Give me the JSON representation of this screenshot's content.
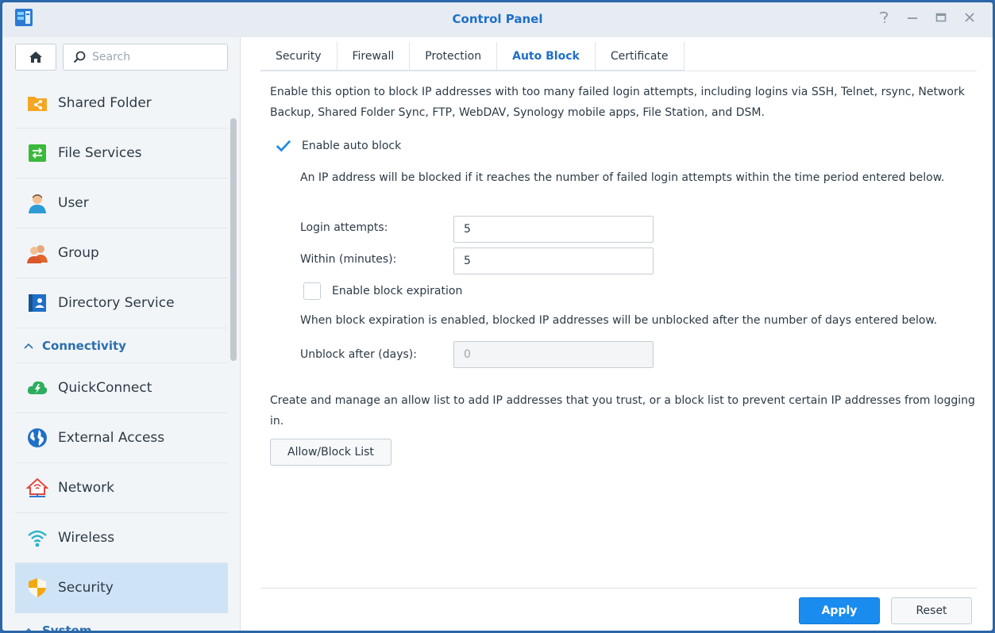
{
  "window": {
    "title": "Control Panel"
  },
  "title_controls": {
    "help_glyph": "?",
    "minimize_glyph": "—",
    "maximize_glyph": "□",
    "close_glyph": "✕"
  },
  "search": {
    "placeholder": "Search"
  },
  "sidebar": {
    "items_top": [
      {
        "label": "Shared Folder",
        "icon": "shared-folder-icon"
      },
      {
        "label": "File Services",
        "icon": "file-services-icon"
      },
      {
        "label": "User",
        "icon": "user-icon"
      },
      {
        "label": "Group",
        "icon": "group-icon"
      },
      {
        "label": "Directory Service",
        "icon": "directory-service-icon"
      }
    ],
    "section_connectivity": "Connectivity",
    "items_connectivity": [
      {
        "label": "QuickConnect",
        "icon": "quickconnect-icon"
      },
      {
        "label": "External Access",
        "icon": "external-access-icon"
      },
      {
        "label": "Network",
        "icon": "network-icon"
      },
      {
        "label": "Wireless",
        "icon": "wireless-icon"
      },
      {
        "label": "Security",
        "icon": "security-shield-icon",
        "active": true
      }
    ],
    "section_system": "System"
  },
  "tabs": [
    {
      "label": "Security"
    },
    {
      "label": "Firewall"
    },
    {
      "label": "Protection"
    },
    {
      "label": "Auto Block",
      "active": true
    },
    {
      "label": "Certificate"
    }
  ],
  "content": {
    "intro": "Enable this option to block IP addresses with too many failed login attempts, including logins via SSH, Telnet, rsync, Network Backup, Shared Folder Sync, FTP, WebDAV, Synology mobile apps, File Station, and DSM.",
    "enable_auto_block": {
      "label": "Enable auto block",
      "checked": true
    },
    "auto_block_desc": "An IP address will be blocked if it reaches the number of failed login attempts within the time period entered below.",
    "login_attempts": {
      "label": "Login attempts:",
      "value": "5"
    },
    "within_minutes": {
      "label": "Within (minutes):",
      "value": "5"
    },
    "enable_block_expiration": {
      "label": "Enable block expiration",
      "checked": false
    },
    "expiration_desc": "When block expiration is enabled, blocked IP addresses will be unblocked after the number of days entered below.",
    "unblock_after": {
      "label": "Unblock after (days):",
      "value": "0"
    },
    "list_desc": "Create and manage an allow list to add IP addresses that you trust, or a block list to prevent certain IP addresses from logging in.",
    "allow_block_button": "Allow/Block List"
  },
  "footer": {
    "apply": "Apply",
    "reset": "Reset"
  },
  "colors": {
    "accent": "#1f6fc9",
    "primary_button": "#1a8cf0",
    "active_nav": "#cfe3f6"
  }
}
